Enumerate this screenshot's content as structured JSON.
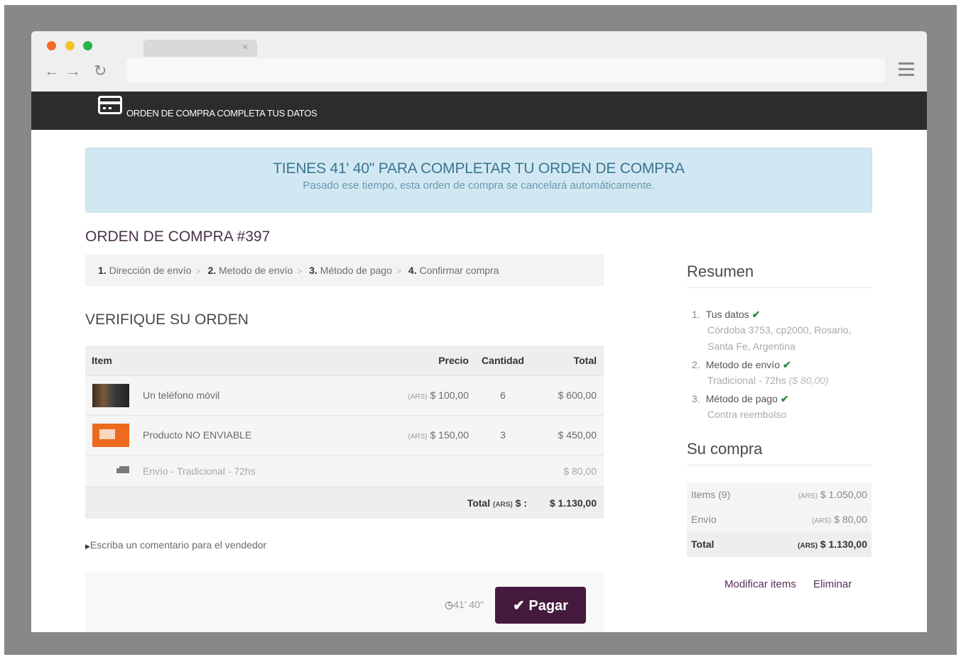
{
  "header": {
    "title": "ORDEN DE COMPRA COMPLETA TUS DATOS"
  },
  "alert": {
    "title": "TIENES 41' 40\" PARA COMPLETAR TU ORDEN DE COMPRA",
    "subtitle": "Pasado ese tiempo, esta orden de compra se cancelará automáticamente."
  },
  "order": {
    "title": "ORDEN DE COMPRA #397"
  },
  "steps": [
    {
      "num": "1.",
      "label": "Dirección de envío"
    },
    {
      "num": "2.",
      "label": "Metodo de envío"
    },
    {
      "num": "3.",
      "label": "Método de pago"
    },
    {
      "num": "4.",
      "label": "Confirmar compra"
    }
  ],
  "verify": {
    "title": "VERIFIQUE SU ORDEN",
    "columns": {
      "item": "Item",
      "price": "Precio",
      "qty": "Cantidad",
      "total": "Total"
    },
    "items": [
      {
        "name": "Un teléfono móvil",
        "currency": "(ARS)",
        "price": "$ 100,00",
        "qty": "6",
        "total": "$ 600,00"
      },
      {
        "name": "Producto NO ENVIABLE",
        "currency": "(ARS)",
        "price": "$ 150,00",
        "qty": "3",
        "total": "$ 450,00"
      }
    ],
    "shipping": {
      "label": "Envío - Tradicional - 72hs",
      "total": "$ 80,00"
    },
    "grand_total": {
      "label": "Total",
      "currency": "(ARS)",
      "suffix": "$ :",
      "value": "$ 1.130,00"
    }
  },
  "comment_link": "Escriba un comentario para el vendedor",
  "payment": {
    "timer": "41' 40\"",
    "button": "Pagar"
  },
  "resumen": {
    "title": "Resumen",
    "items": [
      {
        "num": "1.",
        "label": "Tus datos",
        "detail": "Córdoba 3753, cp2000, Rosario, Santa Fe, Argentina",
        "detail_extra": ""
      },
      {
        "num": "2.",
        "label": "Metodo de envío",
        "detail": "Tradicional - 72hs",
        "detail_extra": "($ 80,00)"
      },
      {
        "num": "3.",
        "label": "Método de pago",
        "detail": "Contra reembolso",
        "detail_extra": ""
      }
    ]
  },
  "su_compra": {
    "title": "Su compra",
    "rows": [
      {
        "label": "Items (9)",
        "currency": "(ARS)",
        "value": "$ 1.050,00"
      },
      {
        "label": "Envío",
        "currency": "(ARS)",
        "value": "$ 80,00"
      },
      {
        "label": "Total",
        "currency": "(ARS)",
        "value": "$ 1.130,00"
      }
    ],
    "links": {
      "modify": "Modificar items",
      "delete": "Eliminar"
    }
  },
  "colors": {
    "topbar": "#2d2b2c",
    "alert_bg": "#d1e8f3",
    "accent": "#451b3d",
    "check": "#2e8b3a"
  }
}
